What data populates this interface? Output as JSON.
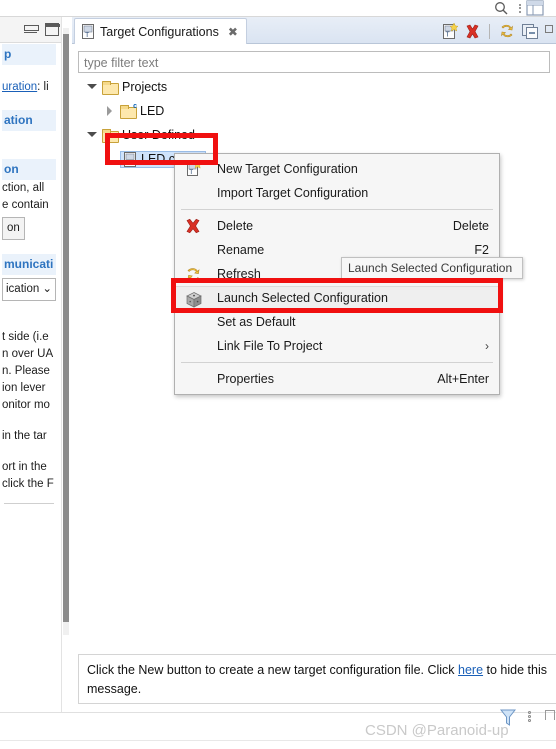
{
  "top_bar": {
    "search_icon": "search-icon",
    "menu_icon": "vertical-dots-icon",
    "grid_icon": "grid-icon"
  },
  "left_help_panel": {
    "minimize_icon": "minimize-icon",
    "maximize_icon": "maximize-icon",
    "fragments": [
      {
        "type": "section",
        "text": "p"
      },
      {
        "type": "blank"
      },
      {
        "type": "link_text",
        "link": "uration",
        "rest": ": li"
      },
      {
        "type": "blank"
      },
      {
        "type": "section",
        "text": "ation"
      },
      {
        "type": "blank"
      },
      {
        "type": "blank"
      },
      {
        "type": "section",
        "text": "on"
      },
      {
        "type": "text",
        "text": "ction, all"
      },
      {
        "type": "text",
        "text": "e contain"
      },
      {
        "type": "button",
        "text": "on"
      },
      {
        "type": "blank"
      },
      {
        "type": "section",
        "text": "municati"
      },
      {
        "type": "select",
        "text": "ication"
      },
      {
        "type": "blank"
      },
      {
        "type": "blank"
      },
      {
        "type": "text",
        "text": "t side (i.e"
      },
      {
        "type": "text",
        "text": "n over UA"
      },
      {
        "type": "text",
        "text": "n. Please"
      },
      {
        "type": "text",
        "text": "ion lever"
      },
      {
        "type": "text",
        "text": "onitor mo"
      },
      {
        "type": "blank"
      },
      {
        "type": "text",
        "text": "in the tar"
      },
      {
        "type": "blank"
      },
      {
        "type": "text",
        "text": "ort in the"
      },
      {
        "type": "text",
        "text": "click the F"
      },
      {
        "type": "rule"
      }
    ],
    "scrollbar": "vertical-scrollbar"
  },
  "view": {
    "tab": {
      "title": "Target Configurations",
      "close_label": "✖",
      "icon": "target-configuration-icon"
    },
    "toolbar": [
      {
        "name": "new-target-configuration-icon",
        "title": "New Target Configuration"
      },
      {
        "name": "delete-icon",
        "title": "Delete"
      },
      {
        "name": "refresh-icon",
        "title": "Refresh"
      },
      {
        "name": "collapse-all-icon",
        "title": "Collapse All"
      },
      {
        "name": "view-menu-icon",
        "title": "View Menu"
      }
    ],
    "filter": {
      "placeholder": "type filter text",
      "value": ""
    },
    "tree": [
      {
        "label": "Projects",
        "icon": "folder-icon",
        "expander": "open",
        "indent": 0
      },
      {
        "label": "LED",
        "icon": "folder-c-icon",
        "expander": "closed",
        "indent": 1
      },
      {
        "label": "User Defined",
        "icon": "folder-icon",
        "expander": "open",
        "indent": 0
      },
      {
        "label": "LED.ccxml",
        "icon": "ccxml-file-icon",
        "expander": "none",
        "indent": 1,
        "selected": true
      }
    ]
  },
  "context_menu": {
    "items": [
      {
        "label": "New Target Configuration",
        "accel": "",
        "icon": "new-target-configuration-icon",
        "submenu": false
      },
      {
        "label": "Import Target Configuration",
        "accel": "",
        "icon": "",
        "submenu": false
      },
      {
        "separator": true
      },
      {
        "label": "Delete",
        "accel": "Delete",
        "icon": "delete-icon",
        "submenu": false
      },
      {
        "label": "Rename",
        "accel": "F2",
        "icon": "",
        "submenu": false
      },
      {
        "label": "Refresh",
        "accel": "",
        "icon": "refresh-icon",
        "submenu": false
      },
      {
        "label": "Launch Selected Configuration",
        "accel": "",
        "icon": "launch-cube-icon",
        "submenu": false,
        "highlighted": true
      },
      {
        "label": "Set as Default",
        "accel": "",
        "icon": "",
        "submenu": false
      },
      {
        "label": "Link File To Project",
        "accel": "",
        "icon": "",
        "submenu": true
      },
      {
        "separator": true
      },
      {
        "label": "Properties",
        "accel": "Alt+Enter",
        "icon": "",
        "submenu": false
      }
    ]
  },
  "tooltip": {
    "text": "Launch Selected Configuration"
  },
  "message": {
    "prefix": "Click the New button to create a new target configuration file. Click ",
    "link": "here",
    "suffix": " to hide this message."
  },
  "bottom_bar": {
    "watermark": "CSDN @Paranoid-up",
    "filter_icon": "funnel-icon",
    "menu_icon": "vertical-dots-icon"
  },
  "colors": {
    "annotation_red": "#f01010",
    "selection_blue": "#cfe3fb",
    "tab_gradient_top": "#e8eef7",
    "link_blue": "#1a60b8",
    "section_blue": "#2e74c0"
  }
}
